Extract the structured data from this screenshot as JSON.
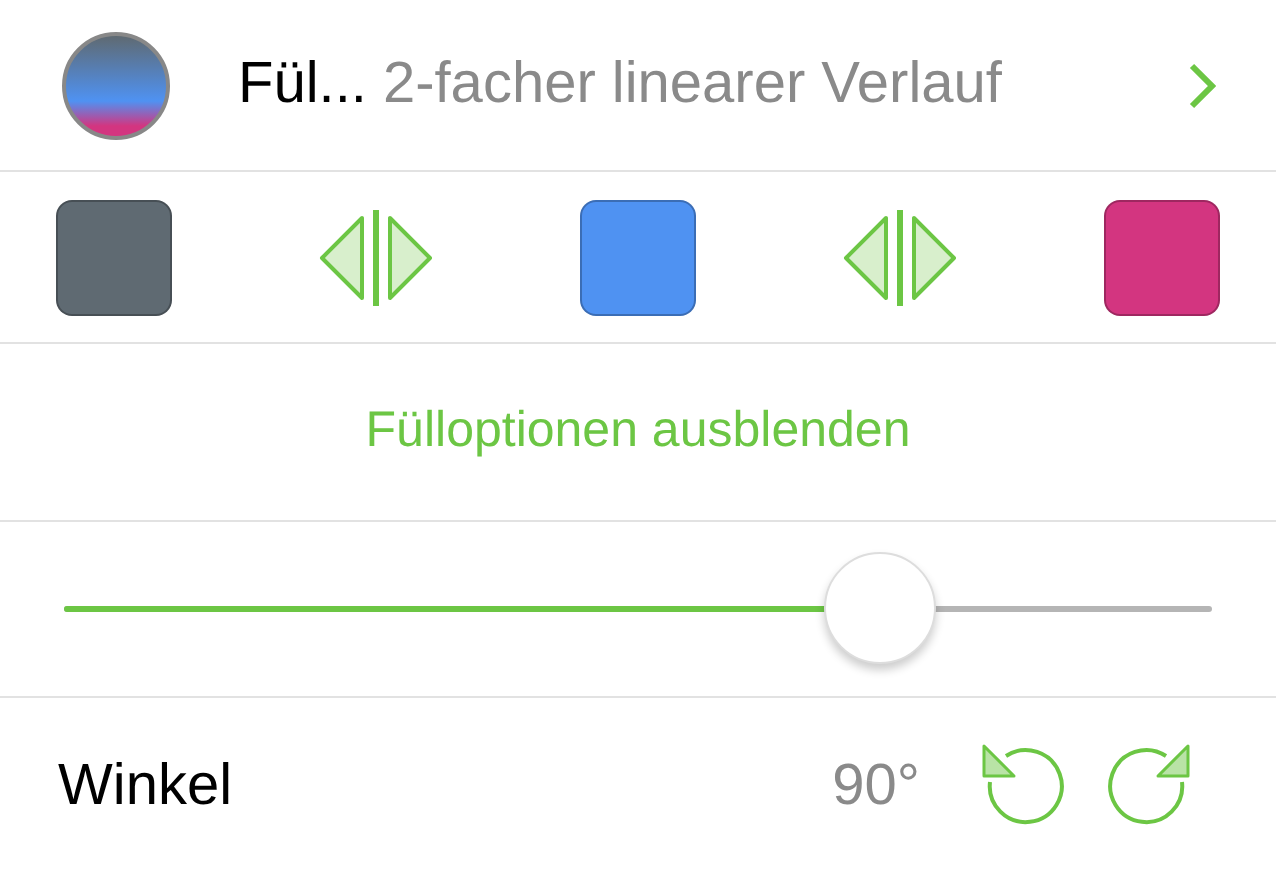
{
  "fill": {
    "label": "Fül...",
    "value": "2-facher linearer Verlauf"
  },
  "stops": [
    {
      "color": "#5f6a72"
    },
    {
      "color": "#4f92f2"
    },
    {
      "color": "#d33580"
    }
  ],
  "toggle_button": "Fülloptionen ausblenden",
  "slider": {
    "level": 0.71
  },
  "angle": {
    "label": "Winkel",
    "value": "90°"
  }
}
